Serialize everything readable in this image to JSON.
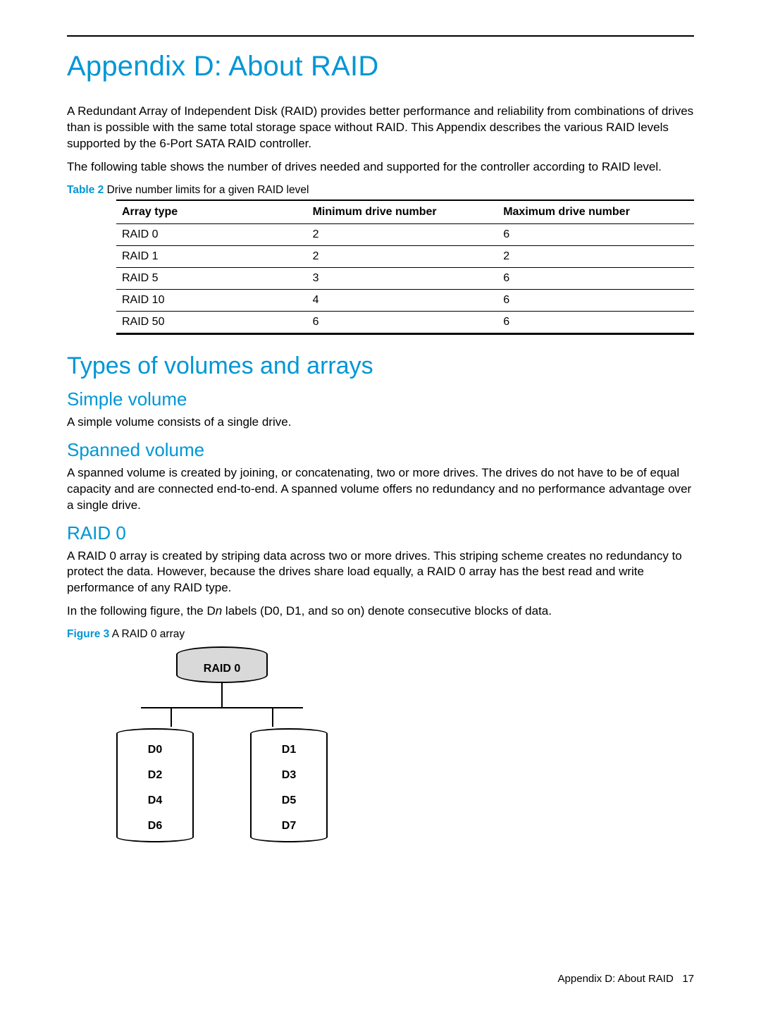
{
  "appendix_title": "Appendix D: About RAID",
  "intro_p1": "A Redundant Array of Independent Disk (RAID) provides better performance and reliability from combinations of drives than is possible with the same total storage space without RAID. This Appendix describes the various RAID levels supported by the 6-Port SATA RAID controller.",
  "intro_p2": "The following table shows the number of drives needed and supported for the controller according to RAID level.",
  "table_caption_label": "Table 2",
  "table_caption_text": " Drive number limits for a given RAID level",
  "table_headers": [
    "Array type",
    "Minimum drive number",
    "Maximum drive number"
  ],
  "table_rows": [
    {
      "type": "RAID 0",
      "min": "2",
      "max": "6"
    },
    {
      "type": "RAID 1",
      "min": "2",
      "max": "2"
    },
    {
      "type": "RAID 5",
      "min": "3",
      "max": "6"
    },
    {
      "type": "RAID 10",
      "min": "4",
      "max": "6"
    },
    {
      "type": "RAID 50",
      "min": "6",
      "max": "6"
    }
  ],
  "section_types_title": "Types of volumes and arrays",
  "simple_title": "Simple volume",
  "simple_text": "A simple volume consists of a single drive.",
  "spanned_title": "Spanned volume",
  "spanned_text": "A spanned volume is created by joining, or concatenating, two or more drives. The drives do not have to be of equal capacity and are connected end-to-end. A spanned volume offers no redundancy and no performance advantage over a single drive.",
  "raid0_title": "RAID 0",
  "raid0_p1": "A RAID 0 array is created by striping data across two or more drives. This striping scheme creates no redundancy to protect the data. However, because the drives share load equally, a RAID 0 array has the best read and write performance of any RAID type.",
  "raid0_p2_pre": "In the following figure, the D",
  "raid0_p2_n": "n",
  "raid0_p2_post": " labels (D0, D1, and so on) denote consecutive blocks of data.",
  "figure_caption_label": "Figure 3",
  "figure_caption_text": " A RAID 0 array",
  "diagram": {
    "top_label": "RAID 0",
    "left_drive": [
      "D0",
      "D2",
      "D4",
      "D6"
    ],
    "right_drive": [
      "D1",
      "D3",
      "D5",
      "D7"
    ]
  },
  "footer_text": "Appendix D: About RAID",
  "footer_page": "17"
}
